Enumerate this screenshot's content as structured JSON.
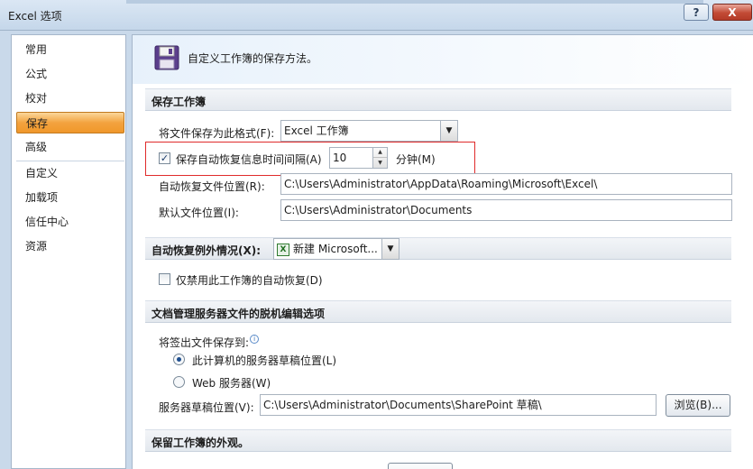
{
  "window": {
    "title": "Excel 选项",
    "help_label": "?",
    "close_label": "X"
  },
  "nav": {
    "items": [
      {
        "label": "常用"
      },
      {
        "label": "公式"
      },
      {
        "label": "校对"
      },
      {
        "label": "保存",
        "selected": true
      },
      {
        "label": "高级"
      },
      {
        "label": "自定义"
      },
      {
        "label": "加载项"
      },
      {
        "label": "信任中心"
      },
      {
        "label": "资源"
      }
    ]
  },
  "banner": {
    "icon": "floppy-disk-icon",
    "text": "自定义工作簿的保存方法。"
  },
  "save_workbooks": {
    "section_title": "保存工作簿",
    "format_label": "将文件保存为此格式(F):",
    "format_value": "Excel 工作簿",
    "autorecover_label": "保存自动恢复信息时间间隔(A)",
    "autorecover_checked": true,
    "autorecover_minutes": "10",
    "minutes_label": "分钟(M)",
    "autorecover_location_label": "自动恢复文件位置(R):",
    "autorecover_location_value": "C:\\Users\\Administrator\\AppData\\Roaming\\Microsoft\\Excel\\",
    "default_location_label": "默认文件位置(I):",
    "default_location_value": "C:\\Users\\Administrator\\Documents"
  },
  "autorecover_exceptions": {
    "section_title": "自动恢复例外情况(X):",
    "workbook_value": "新建 Microsoft...",
    "disable_label": "仅禁用此工作簿的自动恢复(D)",
    "disable_checked": false
  },
  "offline_editing": {
    "section_title": "文档管理服务器文件的脱机编辑选项",
    "checkout_label": "将签出文件保存到:",
    "option_local_label": "此计算机的服务器草稿位置(L)",
    "option_local_selected": true,
    "option_web_label": "Web 服务器(W)",
    "option_web_selected": false,
    "drafts_label": "服务器草稿位置(V):",
    "drafts_value": "C:\\Users\\Administrator\\Documents\\SharePoint 草稿\\",
    "browse_label": "浏览(B)..."
  },
  "preserve_visual": {
    "section_title": "保留工作簿的外观。"
  },
  "colors": {
    "selected_nav": "#f3a33f",
    "highlight_box": "#e02b2b",
    "accent_blue": "#1f4f8f"
  }
}
